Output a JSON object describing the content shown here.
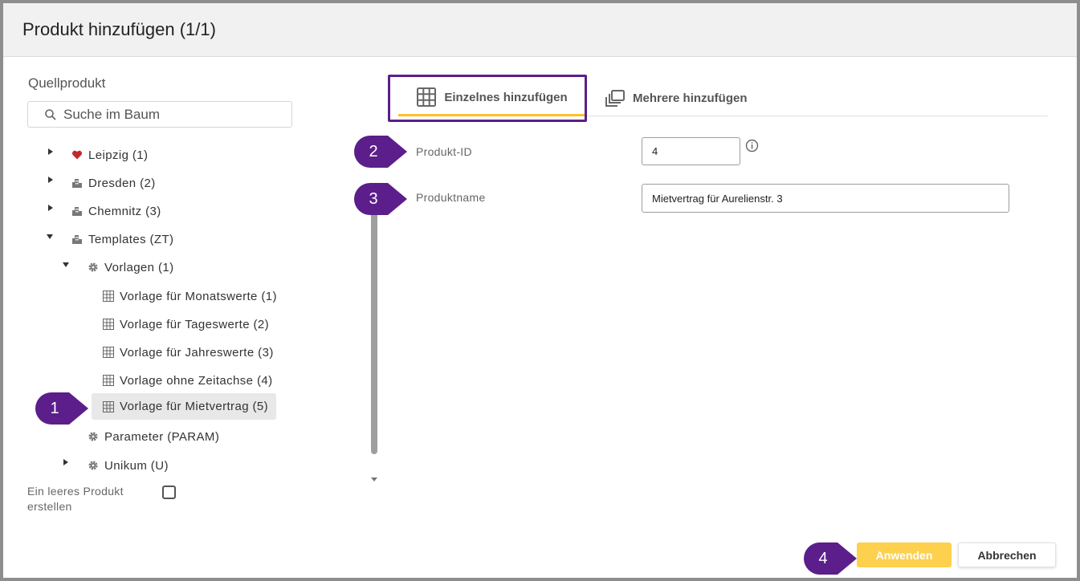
{
  "dialog": {
    "title": "Produkt hinzufügen (1/1)"
  },
  "source": {
    "label": "Quellprodukt",
    "search_placeholder": "Suche im Baum"
  },
  "tree": {
    "items": [
      {
        "label": "Leipzig (1)",
        "icon": "heart-icon",
        "expander": "collapsed"
      },
      {
        "label": "Dresden (2)",
        "icon": "building-icon",
        "expander": "collapsed"
      },
      {
        "label": "Chemnitz (3)",
        "icon": "building-icon",
        "expander": "collapsed"
      },
      {
        "label": "Templates (ZT)",
        "icon": "building-icon",
        "expander": "expanded"
      },
      {
        "label": "Vorlagen (1)",
        "icon": "gear-icon",
        "expander": "expanded"
      },
      {
        "label": "Vorlage für Monatswerte (1)",
        "icon": "grid-icon"
      },
      {
        "label": "Vorlage für Tageswerte (2)",
        "icon": "grid-icon"
      },
      {
        "label": "Vorlage für Jahreswerte (3)",
        "icon": "grid-icon"
      },
      {
        "label": "Vorlage ohne Zeitachse (4)",
        "icon": "grid-icon"
      },
      {
        "label": "Vorlage für Mietvertrag (5)",
        "icon": "grid-icon",
        "selected": true
      },
      {
        "label": "Parameter (PARAM)",
        "icon": "gear-icon"
      },
      {
        "label": "Unikum (U)",
        "icon": "gear-icon",
        "expander": "collapsed"
      }
    ]
  },
  "empty_product": {
    "label_line1": "Ein leeres Produkt",
    "label_line2": "erstellen",
    "checked": false
  },
  "tabs": [
    {
      "label": "Einzelnes hinzufügen",
      "icon": "grid-icon",
      "active": true
    },
    {
      "label": "Mehrere hinzufügen",
      "icon": "copy-icon",
      "active": false
    }
  ],
  "form": {
    "product_id": {
      "label": "Produkt-ID",
      "value": "4"
    },
    "product_name": {
      "label": "Produktname",
      "value": "Mietvertrag für Aurelienstr. 3"
    }
  },
  "callouts": [
    "1",
    "2",
    "3",
    "4"
  ],
  "buttons": {
    "apply": "Anwenden",
    "cancel": "Abbrechen"
  },
  "colors": {
    "accent": "#fbc02d",
    "callout": "#5b1e8a",
    "apply_button": "#fdd04e"
  }
}
